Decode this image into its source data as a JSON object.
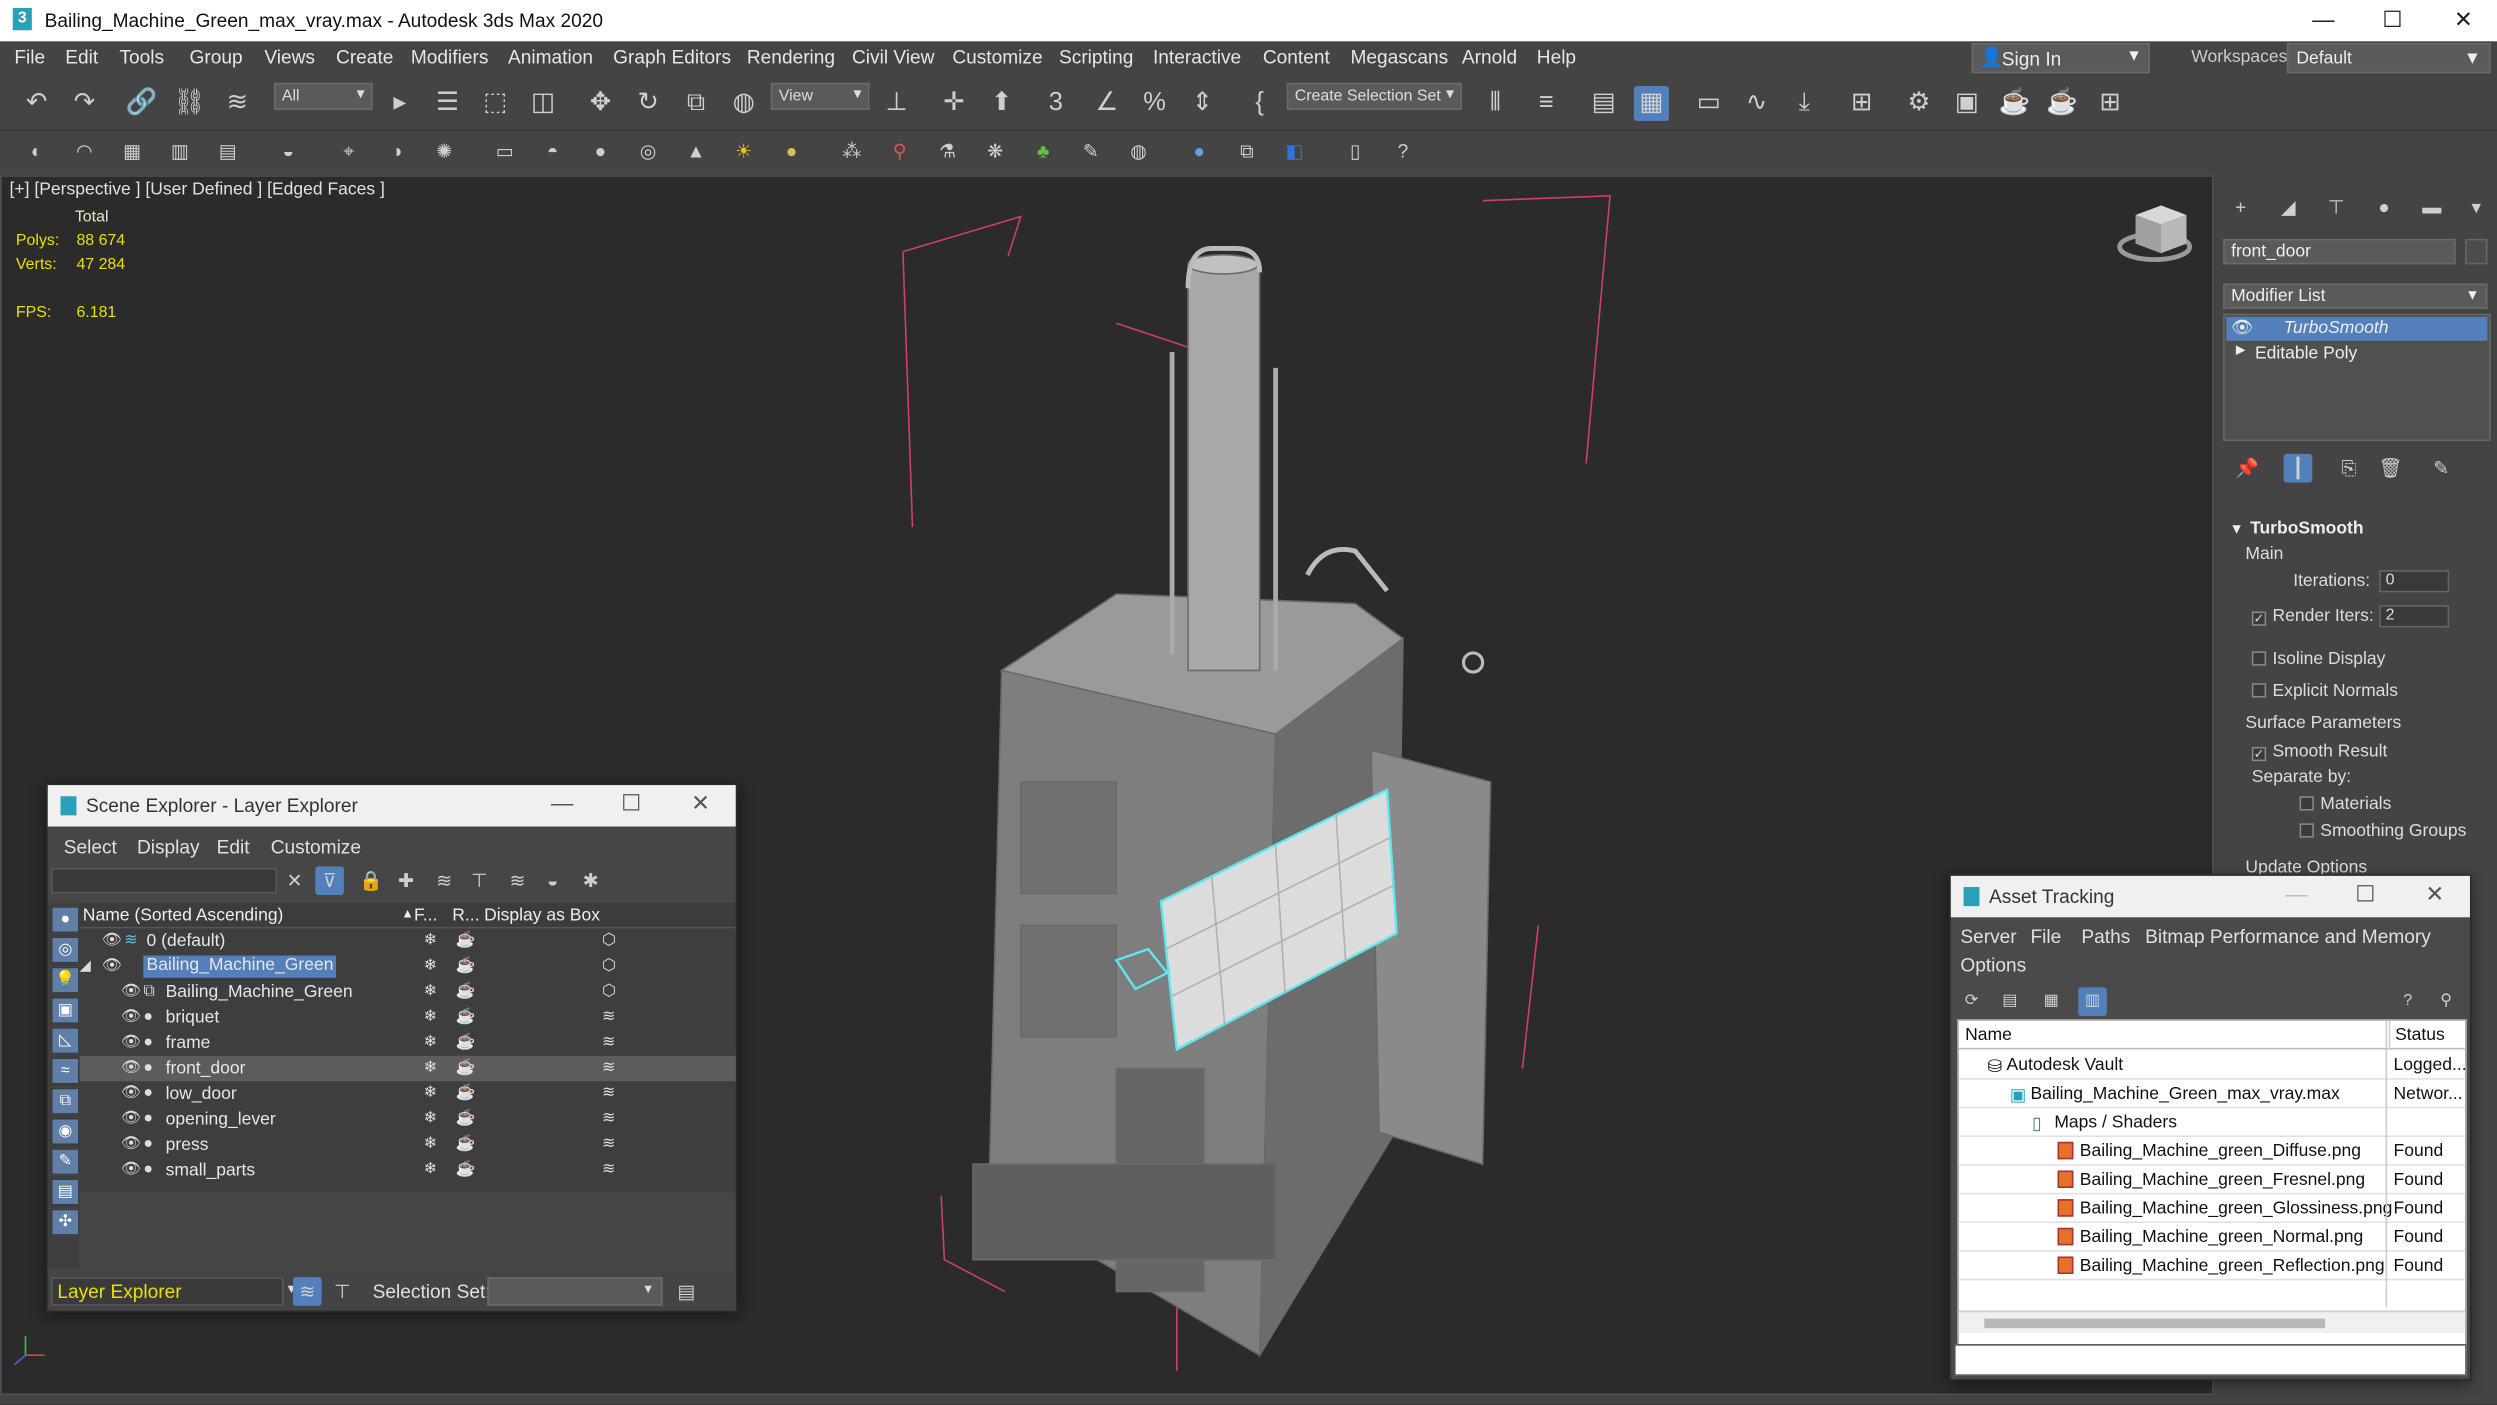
{
  "app": {
    "title": "Bailing_Machine_Green_max_vray.max - Autodesk 3ds Max 2020",
    "window_controls": [
      "—",
      "☐",
      "✕"
    ]
  },
  "menu": [
    "File",
    "Edit",
    "Tools",
    "Group",
    "Views",
    "Create",
    "Modifiers",
    "Animation",
    "Graph Editors",
    "Rendering",
    "Civil View",
    "Customize",
    "Scripting",
    "Interactive",
    "Content",
    "Megascans",
    "Arnold",
    "Help"
  ],
  "account": {
    "sign_in": "Sign In",
    "workspaces_label": "Workspaces:",
    "workspace": "Default"
  },
  "toolbar": {
    "filter": "All",
    "ref_coord": "View",
    "selection_set": "Create Selection Set"
  },
  "viewport": {
    "label": "[+] [Perspective ] [User Defined ] [Edged Faces ]",
    "stats_header": "Total",
    "polys_label": "Polys:",
    "polys_value": "88 674",
    "verts_label": "Verts:",
    "verts_value": "47 284",
    "fps_label": "FPS:",
    "fps_value": "6.181"
  },
  "command_panel": {
    "object_name": "front_door",
    "modifier_list": "Modifier List",
    "stack": [
      "TurboSmooth",
      "Editable Poly"
    ],
    "rollout_title": "TurboSmooth",
    "main": "Main",
    "iterations_label": "Iterations:",
    "iterations_value": "0",
    "render_iters_label": "Render Iters:",
    "render_iters_value": "2",
    "isoline": "Isoline Display",
    "explicit_normals": "Explicit Normals",
    "surface_params": "Surface Parameters",
    "smooth_result": "Smooth Result",
    "separate_by": "Separate by:",
    "materials": "Materials",
    "smoothing_groups": "Smoothing Groups",
    "update_options": "Update Options"
  },
  "scene_explorer": {
    "title": "Scene Explorer - Layer Explorer",
    "menu": [
      "Select",
      "Display",
      "Edit",
      "Customize"
    ],
    "col_name": "Name (Sorted Ascending)",
    "col_f": "F...",
    "col_r": "R...",
    "col_box": "Display as Box",
    "rows": [
      {
        "name": "0 (default)",
        "indent": 0
      },
      {
        "name": "Bailing_Machine_Green",
        "indent": 0
      },
      {
        "name": "Bailing_Machine_Green",
        "indent": 1
      },
      {
        "name": "briquet",
        "indent": 1
      },
      {
        "name": "frame",
        "indent": 1
      },
      {
        "name": "front_door",
        "indent": 1
      },
      {
        "name": "low_door",
        "indent": 1
      },
      {
        "name": "opening_lever",
        "indent": 1
      },
      {
        "name": "press",
        "indent": 1
      },
      {
        "name": "small_parts",
        "indent": 1
      }
    ],
    "footer_mode": "Layer Explorer",
    "selection_set_label": "Selection Set:"
  },
  "asset_tracking": {
    "title": "Asset Tracking",
    "menu": [
      "Server",
      "File",
      "Paths",
      "Bitmap Performance and Memory",
      "Options"
    ],
    "col_name": "Name",
    "col_status": "Status",
    "rows": [
      {
        "name": "Autodesk Vault",
        "status": "Logged...",
        "indent": 1
      },
      {
        "name": "Bailing_Machine_Green_max_vray.max",
        "status": "Networ...",
        "indent": 2
      },
      {
        "name": "Maps / Shaders",
        "status": "",
        "indent": 3
      },
      {
        "name": "Bailing_Machine_green_Diffuse.png",
        "status": "Found",
        "indent": 4
      },
      {
        "name": "Bailing_Machine_green_Fresnel.png",
        "status": "Found",
        "indent": 4
      },
      {
        "name": "Bailing_Machine_green_Glossiness.png",
        "status": "Found",
        "indent": 4
      },
      {
        "name": "Bailing_Machine_green_Normal.png",
        "status": "Found",
        "indent": 4
      },
      {
        "name": "Bailing_Machine_green_Reflection.png",
        "status": "Found",
        "indent": 4
      }
    ]
  },
  "colors": {
    "accent": "#5380ba",
    "stats": "#e8e000",
    "selection": "#5de8f0"
  }
}
